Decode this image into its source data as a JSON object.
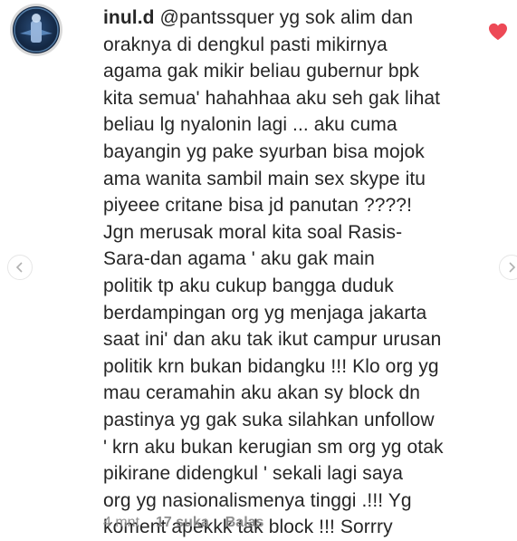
{
  "comment": {
    "username": "inul.d",
    "mention": "@pantssquer",
    "lines": [
      " yg sok alim dan",
      "oraknya di dengkul pasti mikirnya",
      "agama gak mikir beliau gubernur bpk",
      "kita semua' hahahhaa aku seh gak lihat",
      "beliau lg nyalonin lagi ... aku cuma",
      "bayangin yg pake syurban bisa mojok",
      "ama wanita sambil main sex skype itu",
      "piyeee critane bisa jd panutan ????!",
      "Jgn merusak moral  kita soal Rasis-",
      "Sara-dan agama ' aku gak main",
      "politik tp aku cukup bangga duduk",
      "berdampingan org yg menjaga jakarta",
      "saat ini' dan aku tak ikut campur urusan",
      "politik krn bukan bidangku !!! Klo org yg",
      "mau ceramahin aku akan sy block dn",
      "pastinya yg gak suka silahkan unfollow",
      "' krn aku bukan kerugian sm org yg otak",
      "pikirane didengkul ' sekali lagi saya",
      "org yg nasionalismenya tinggi .!!! Yg",
      "koment apekkk tak block !!! Sorrry"
    ]
  },
  "meta": {
    "time": "4 mnt",
    "likes": "17 suka",
    "reply": "Balas"
  },
  "colors": {
    "text": "#262626",
    "meta": "#8e8e8e",
    "heart": "#ed4956"
  }
}
